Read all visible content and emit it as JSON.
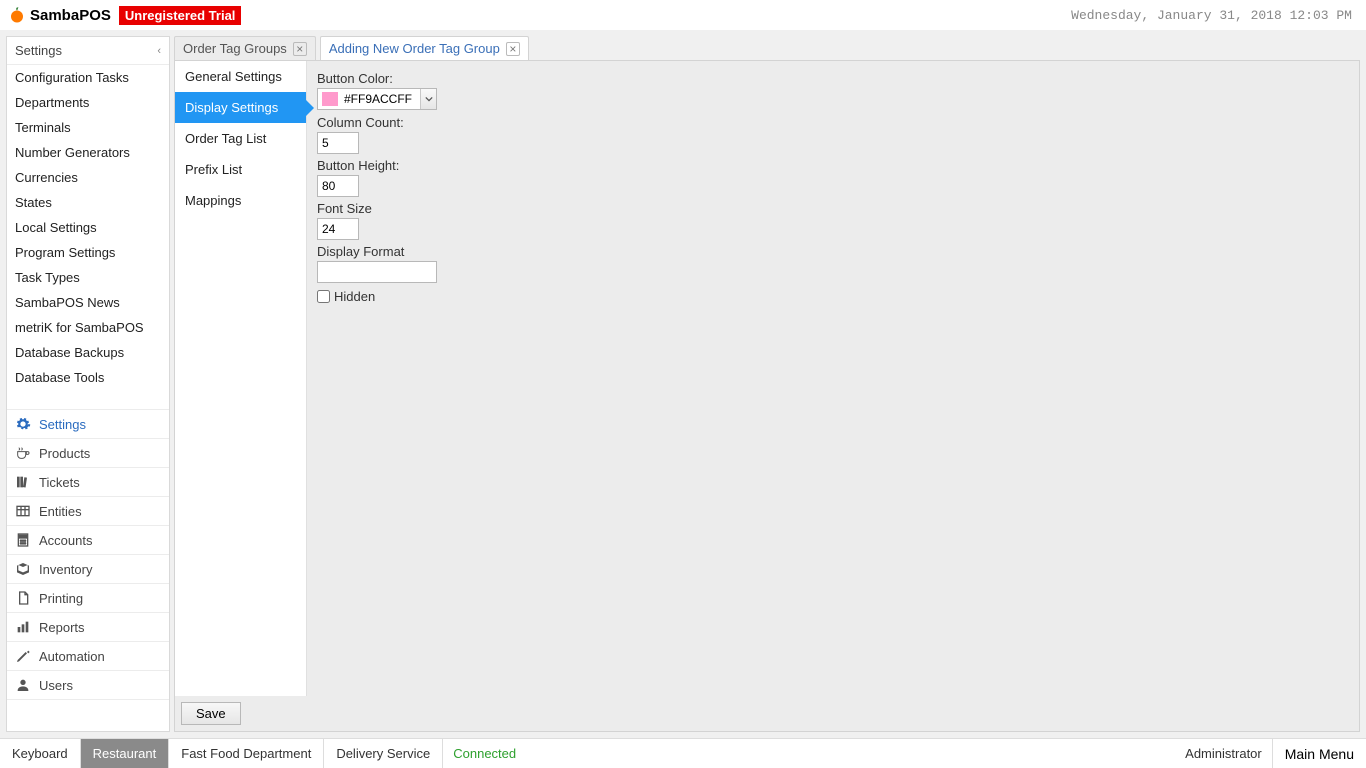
{
  "brand": {
    "name": "SambaPOS",
    "trial_badge": "Unregistered Trial"
  },
  "datetime": "Wednesday, January 31, 2018 12:03 PM",
  "sidebar": {
    "header": "Settings",
    "items": [
      "Configuration Tasks",
      "Departments",
      "Terminals",
      "Number Generators",
      "Currencies",
      "States",
      "Local Settings",
      "Program Settings",
      "Task Types",
      "SambaPOS News",
      "metriK for SambaPOS",
      "Database Backups",
      "Database Tools"
    ],
    "modules": [
      {
        "icon": "gear-icon",
        "label": "Settings",
        "active": true
      },
      {
        "icon": "coffee-icon",
        "label": "Products"
      },
      {
        "icon": "books-icon",
        "label": "Tickets"
      },
      {
        "icon": "table-icon",
        "label": "Entities"
      },
      {
        "icon": "calculator-icon",
        "label": "Accounts"
      },
      {
        "icon": "box-icon",
        "label": "Inventory"
      },
      {
        "icon": "page-icon",
        "label": "Printing"
      },
      {
        "icon": "bars-icon",
        "label": "Reports"
      },
      {
        "icon": "pencil-icon",
        "label": "Automation"
      },
      {
        "icon": "user-icon",
        "label": "Users"
      }
    ]
  },
  "tabs": [
    {
      "label": "Order Tag Groups",
      "active": false
    },
    {
      "label": "Adding New Order Tag Group",
      "active": true
    }
  ],
  "subside": {
    "items": [
      "General Settings",
      "Display Settings",
      "Order Tag List",
      "Prefix List",
      "Mappings"
    ],
    "selected_index": 1
  },
  "form": {
    "button_color_label": "Button Color:",
    "button_color_hex": "#FF9ACCFF",
    "swatch_css": "#ff9acc",
    "column_count_label": "Column Count:",
    "column_count": "5",
    "button_height_label": "Button Height:",
    "button_height": "80",
    "font_size_label": "Font Size",
    "font_size": "24",
    "display_format_label": "Display Format",
    "display_format": "",
    "hidden_label": "Hidden",
    "hidden_checked": false
  },
  "save_label": "Save",
  "bottom": {
    "buttons": [
      {
        "label": "Keyboard",
        "selected": false
      },
      {
        "label": "Restaurant",
        "selected": true
      },
      {
        "label": "Fast Food Department",
        "selected": false
      },
      {
        "label": "Delivery Service",
        "selected": false
      }
    ],
    "status": "Connected",
    "user": "Administrator",
    "main_menu": "Main Menu"
  }
}
